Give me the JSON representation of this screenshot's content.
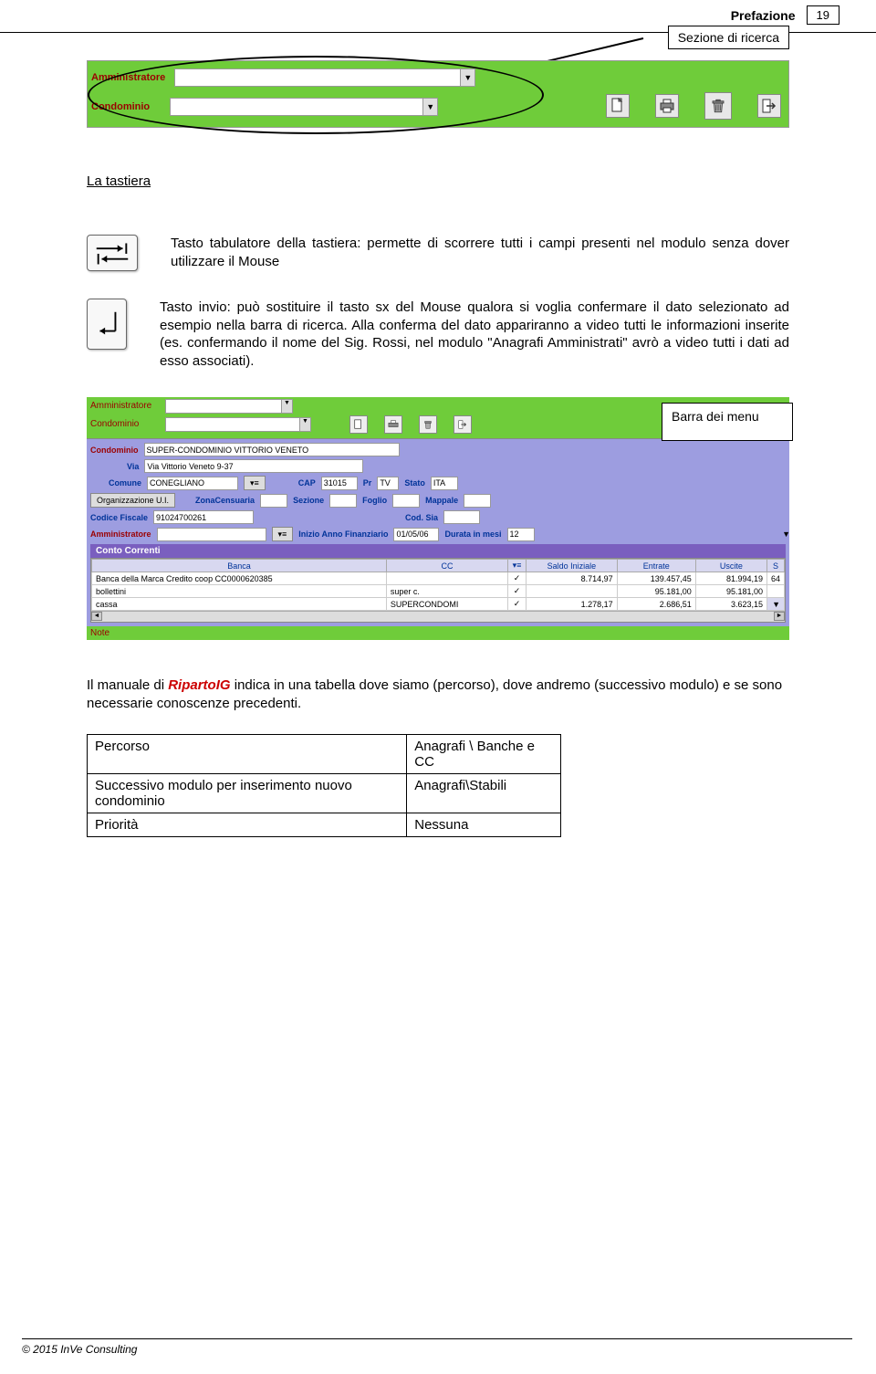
{
  "header": {
    "title": "Prefazione",
    "page_num": "19"
  },
  "callouts": {
    "search_section": "Sezione di  ricerca",
    "menu_bar": "Barra dei menu"
  },
  "panel1": {
    "label1": "Amministratore",
    "label2": "Condominio"
  },
  "section_title": "La tastiera",
  "key1": "Tasto tabulatore della tastiera: permette di scorrere tutti i campi presenti nel modulo senza dover utilizzare il Mouse",
  "key2": "Tasto invio: può sostituire il tasto sx del Mouse qualora si voglia confermare il dato selezionato ad esempio nella barra di ricerca. Alla conferma del dato appariranno a video tutti le informazioni inserite (es. confermando il nome del Sig. Rossi, nel modulo \"Anagrafi Amministrati\" avrò a video tutti i dati ad esso associati).",
  "panel2": {
    "top_label1": "Amministratore",
    "top_label2": "Condominio",
    "condominio_label": "Condominio",
    "condominio_value": "SUPER-CONDOMINIO VITTORIO VENETO",
    "via_label": "Via",
    "via_value": "Via Vittorio Veneto 9-37",
    "comune_label": "Comune",
    "comune_value": "CONEGLIANO",
    "cap_label": "CAP",
    "cap_value": "31015",
    "pr_label": "Pr",
    "pr_value": "TV",
    "stato_label": "Stato",
    "stato_value": "ITA",
    "org_btn": "Organizzazione U.I.",
    "zona_label": "ZonaCensuaria",
    "sezione_label": "Sezione",
    "foglio_label": "Foglio",
    "mappale_label": "Mappale",
    "cf_label": "Codice Fiscale",
    "cf_value": "91024700261",
    "codsia_label": "Cod. Sia",
    "ammin_label": "Amministratore",
    "inizio_label": "Inizio Anno Finanziario",
    "inizio_value": "01/05/06",
    "durata_label": "Durata in mesi",
    "durata_value": "12",
    "conto_correnti": "Conto Correnti",
    "table": {
      "headers": [
        "Banca",
        "CC",
        "",
        "Saldo Iniziale",
        "Entrate",
        "Uscite",
        "S"
      ],
      "rows": [
        [
          "Banca della Marca Credito coop CC0000620385",
          "",
          "✓",
          "8.714,97",
          "139.457,45",
          "81.994,19",
          "64"
        ],
        [
          "bollettini",
          "super c.",
          "✓",
          "",
          "95.181,00",
          "95.181,00",
          ""
        ],
        [
          "cassa",
          "SUPERCONDOMI",
          "✓",
          "1.278,17",
          "2.686,51",
          "3.623,15",
          ""
        ]
      ]
    },
    "note": "Note"
  },
  "para": {
    "pre": "Il manuale di ",
    "em": "RipartoIG",
    "post": " indica in una tabella dove siamo (percorso), dove andremo (successivo modulo) e se sono necessarie conoscenze precedenti."
  },
  "info_table": {
    "r1c1": "Percorso",
    "r1c2": "Anagrafi \\ Banche e CC",
    "r2c1": "Successivo modulo per inserimento nuovo condominio",
    "r2c2": "Anagrafi\\Stabili",
    "r3c1": "Priorità",
    "r3c2": "Nessuna"
  },
  "footer": "© 2015 InVe Consulting"
}
